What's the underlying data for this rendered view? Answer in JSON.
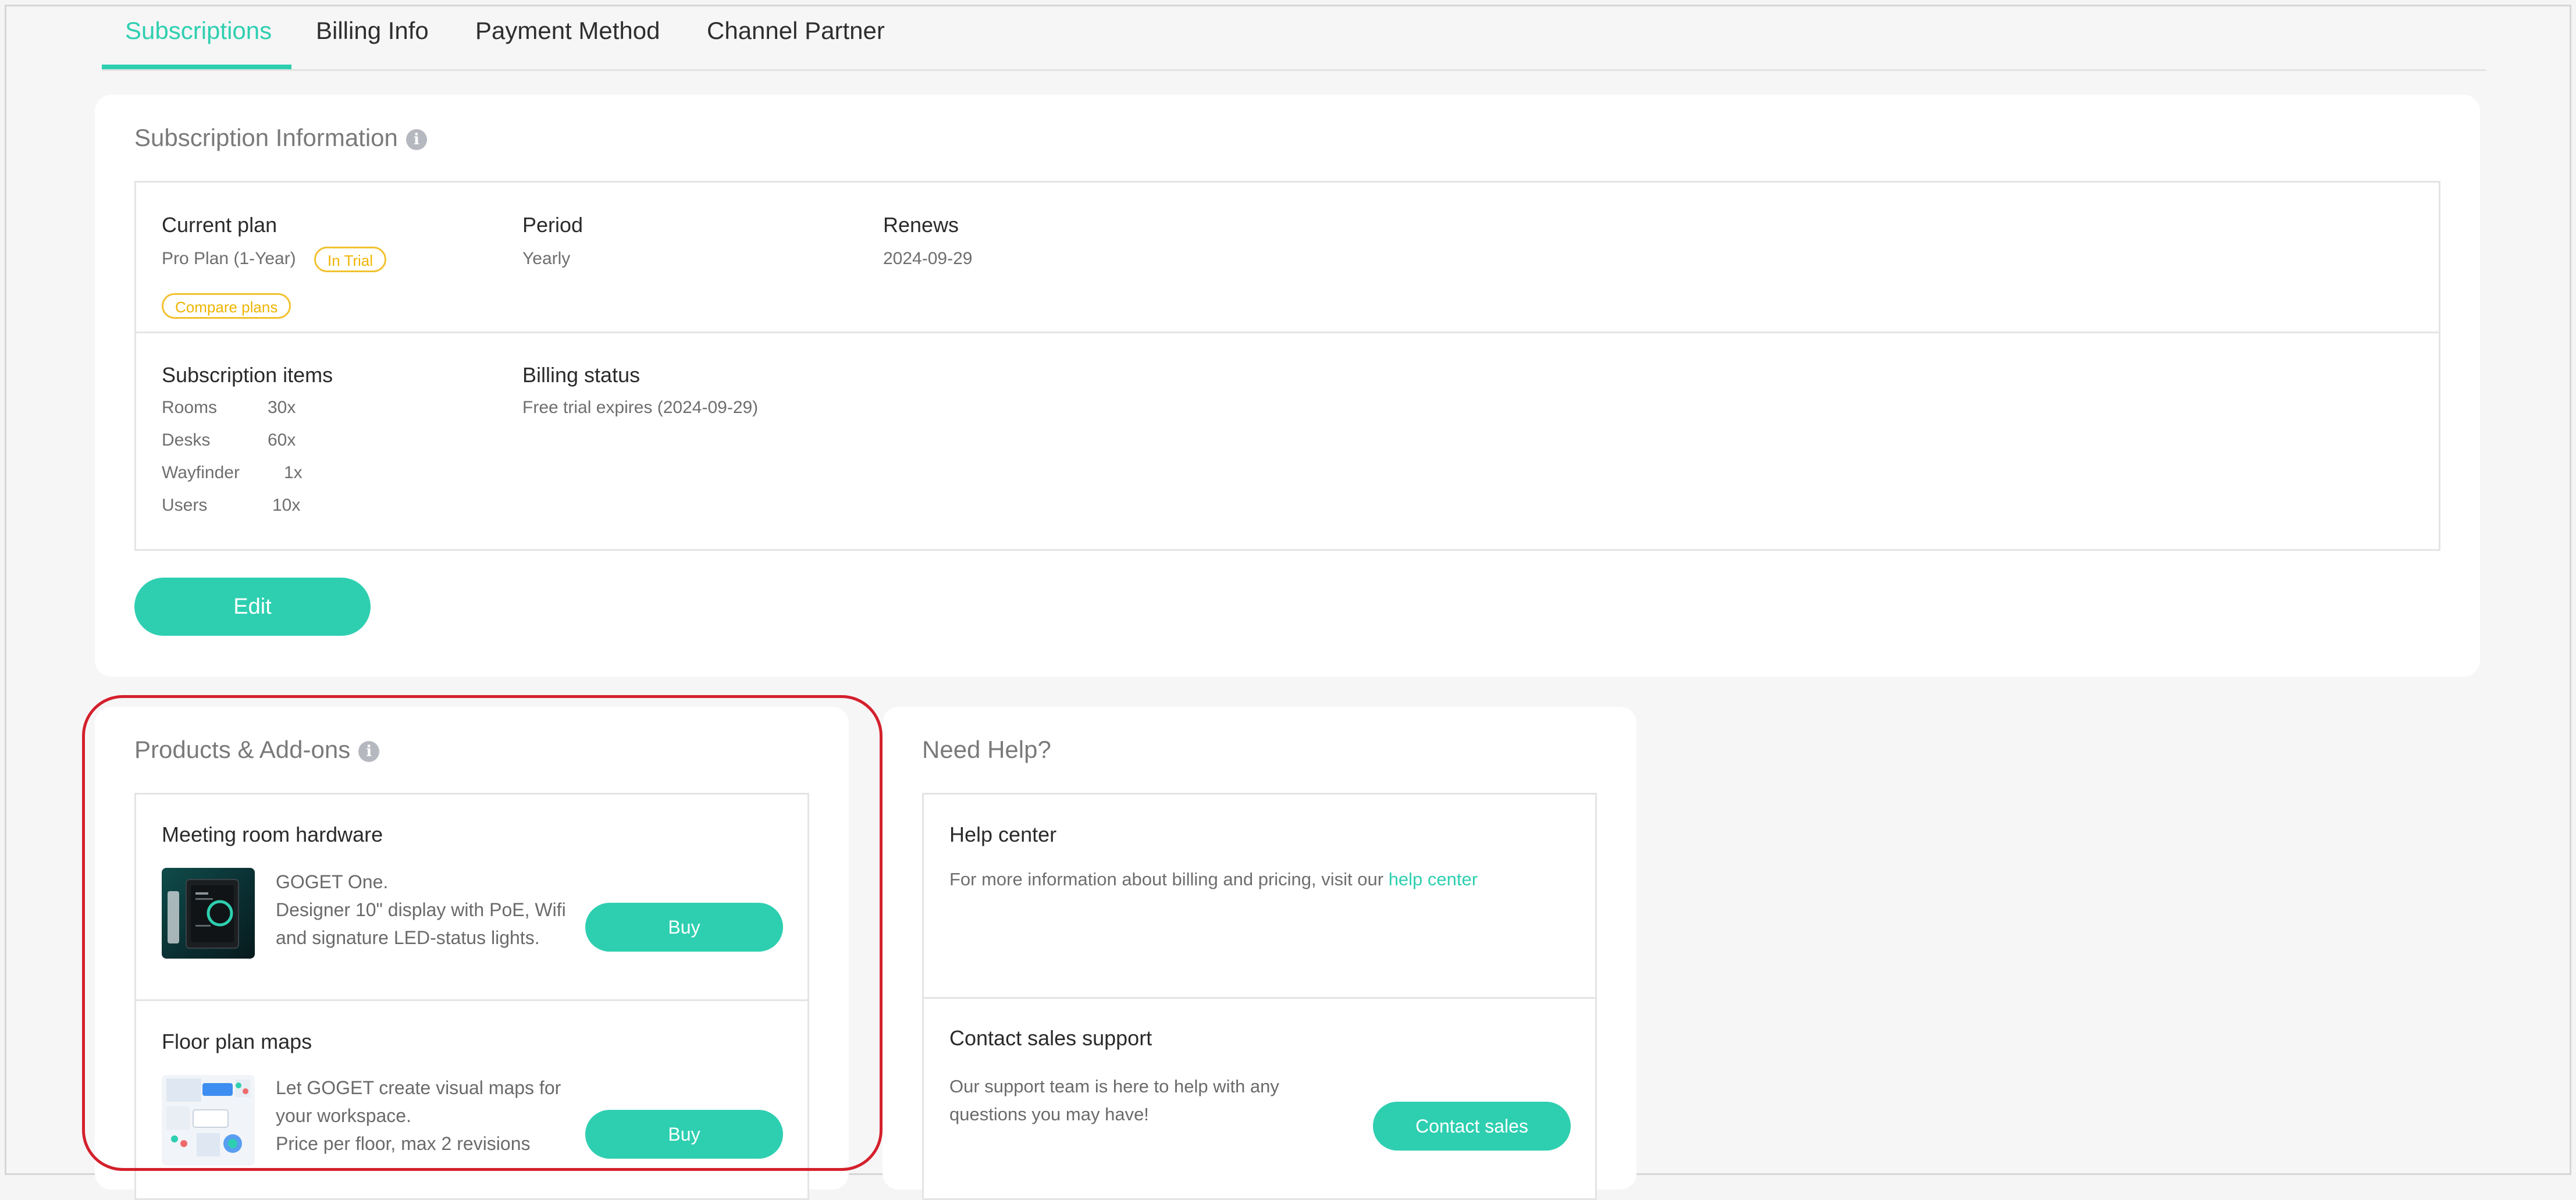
{
  "tabs": [
    {
      "label": "Subscriptions",
      "active": true
    },
    {
      "label": "Billing Info",
      "active": false
    },
    {
      "label": "Payment Method",
      "active": false
    },
    {
      "label": "Channel Partner",
      "active": false
    }
  ],
  "subscription": {
    "title": "Subscription Information",
    "current_plan_label": "Current plan",
    "plan_name": "Pro Plan (1-Year)",
    "trial_badge": "In Trial",
    "compare_label": "Compare plans",
    "period_label": "Period",
    "period_value": "Yearly",
    "renews_label": "Renews",
    "renews_value": "2024-09-29",
    "items_label": "Subscription items",
    "items": [
      {
        "name": "Rooms",
        "qty": "30x"
      },
      {
        "name": "Desks",
        "qty": "60x"
      },
      {
        "name": "Wayfinder",
        "qty": "1x"
      },
      {
        "name": "Users",
        "qty": "10x"
      }
    ],
    "billing_status_label": "Billing status",
    "billing_status_value": "Free trial expires (2024-09-29)",
    "edit_label": "Edit"
  },
  "products": {
    "title": "Products & Add-ons",
    "items": [
      {
        "title": "Meeting room hardware",
        "line1": "GOGET One.",
        "line2": "Designer 10\" display with PoE, Wifi",
        "line3": "and signature LED-status lights.",
        "button": "Buy"
      },
      {
        "title": "Floor plan maps",
        "line1": "Let GOGET create visual maps for",
        "line2": "your workspace.",
        "line3": "Price per floor, max 2 revisions",
        "button": "Buy"
      }
    ]
  },
  "help": {
    "title": "Need Help?",
    "center_title": "Help center",
    "center_text": "For more information about billing and pricing, visit our ",
    "center_link": "help center",
    "sales_title": "Contact sales support",
    "sales_line1": "Our support team is here to help with any",
    "sales_line2": "questions you may have!",
    "sales_button": "Contact sales"
  },
  "colors": {
    "accent": "#2ecfb0",
    "badge": "#f0b400",
    "highlight": "#d4202c"
  }
}
